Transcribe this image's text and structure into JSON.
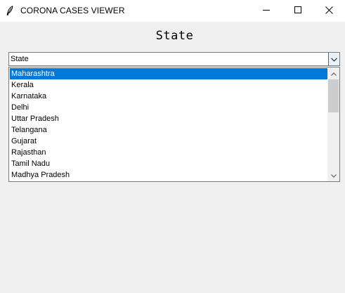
{
  "window": {
    "title": "CORONA CASES VIEWER",
    "icons": [
      "feather-icon",
      "minimize-icon",
      "maximize-icon",
      "close-icon"
    ]
  },
  "main": {
    "heading": "State",
    "combobox": {
      "selected_value": "State",
      "icon": "chevron-down-icon",
      "accent_color": "#0078d7"
    },
    "dropdown": {
      "items": [
        "Maharashtra",
        "Kerala",
        "Karnataka",
        "Delhi",
        "Uttar Pradesh",
        "Telangana",
        "Gujarat",
        "Rajasthan",
        "Tamil Nadu",
        "Madhya Pradesh"
      ],
      "highlighted_item": "Maharashtra",
      "highlight_color": "#0078d7"
    }
  }
}
